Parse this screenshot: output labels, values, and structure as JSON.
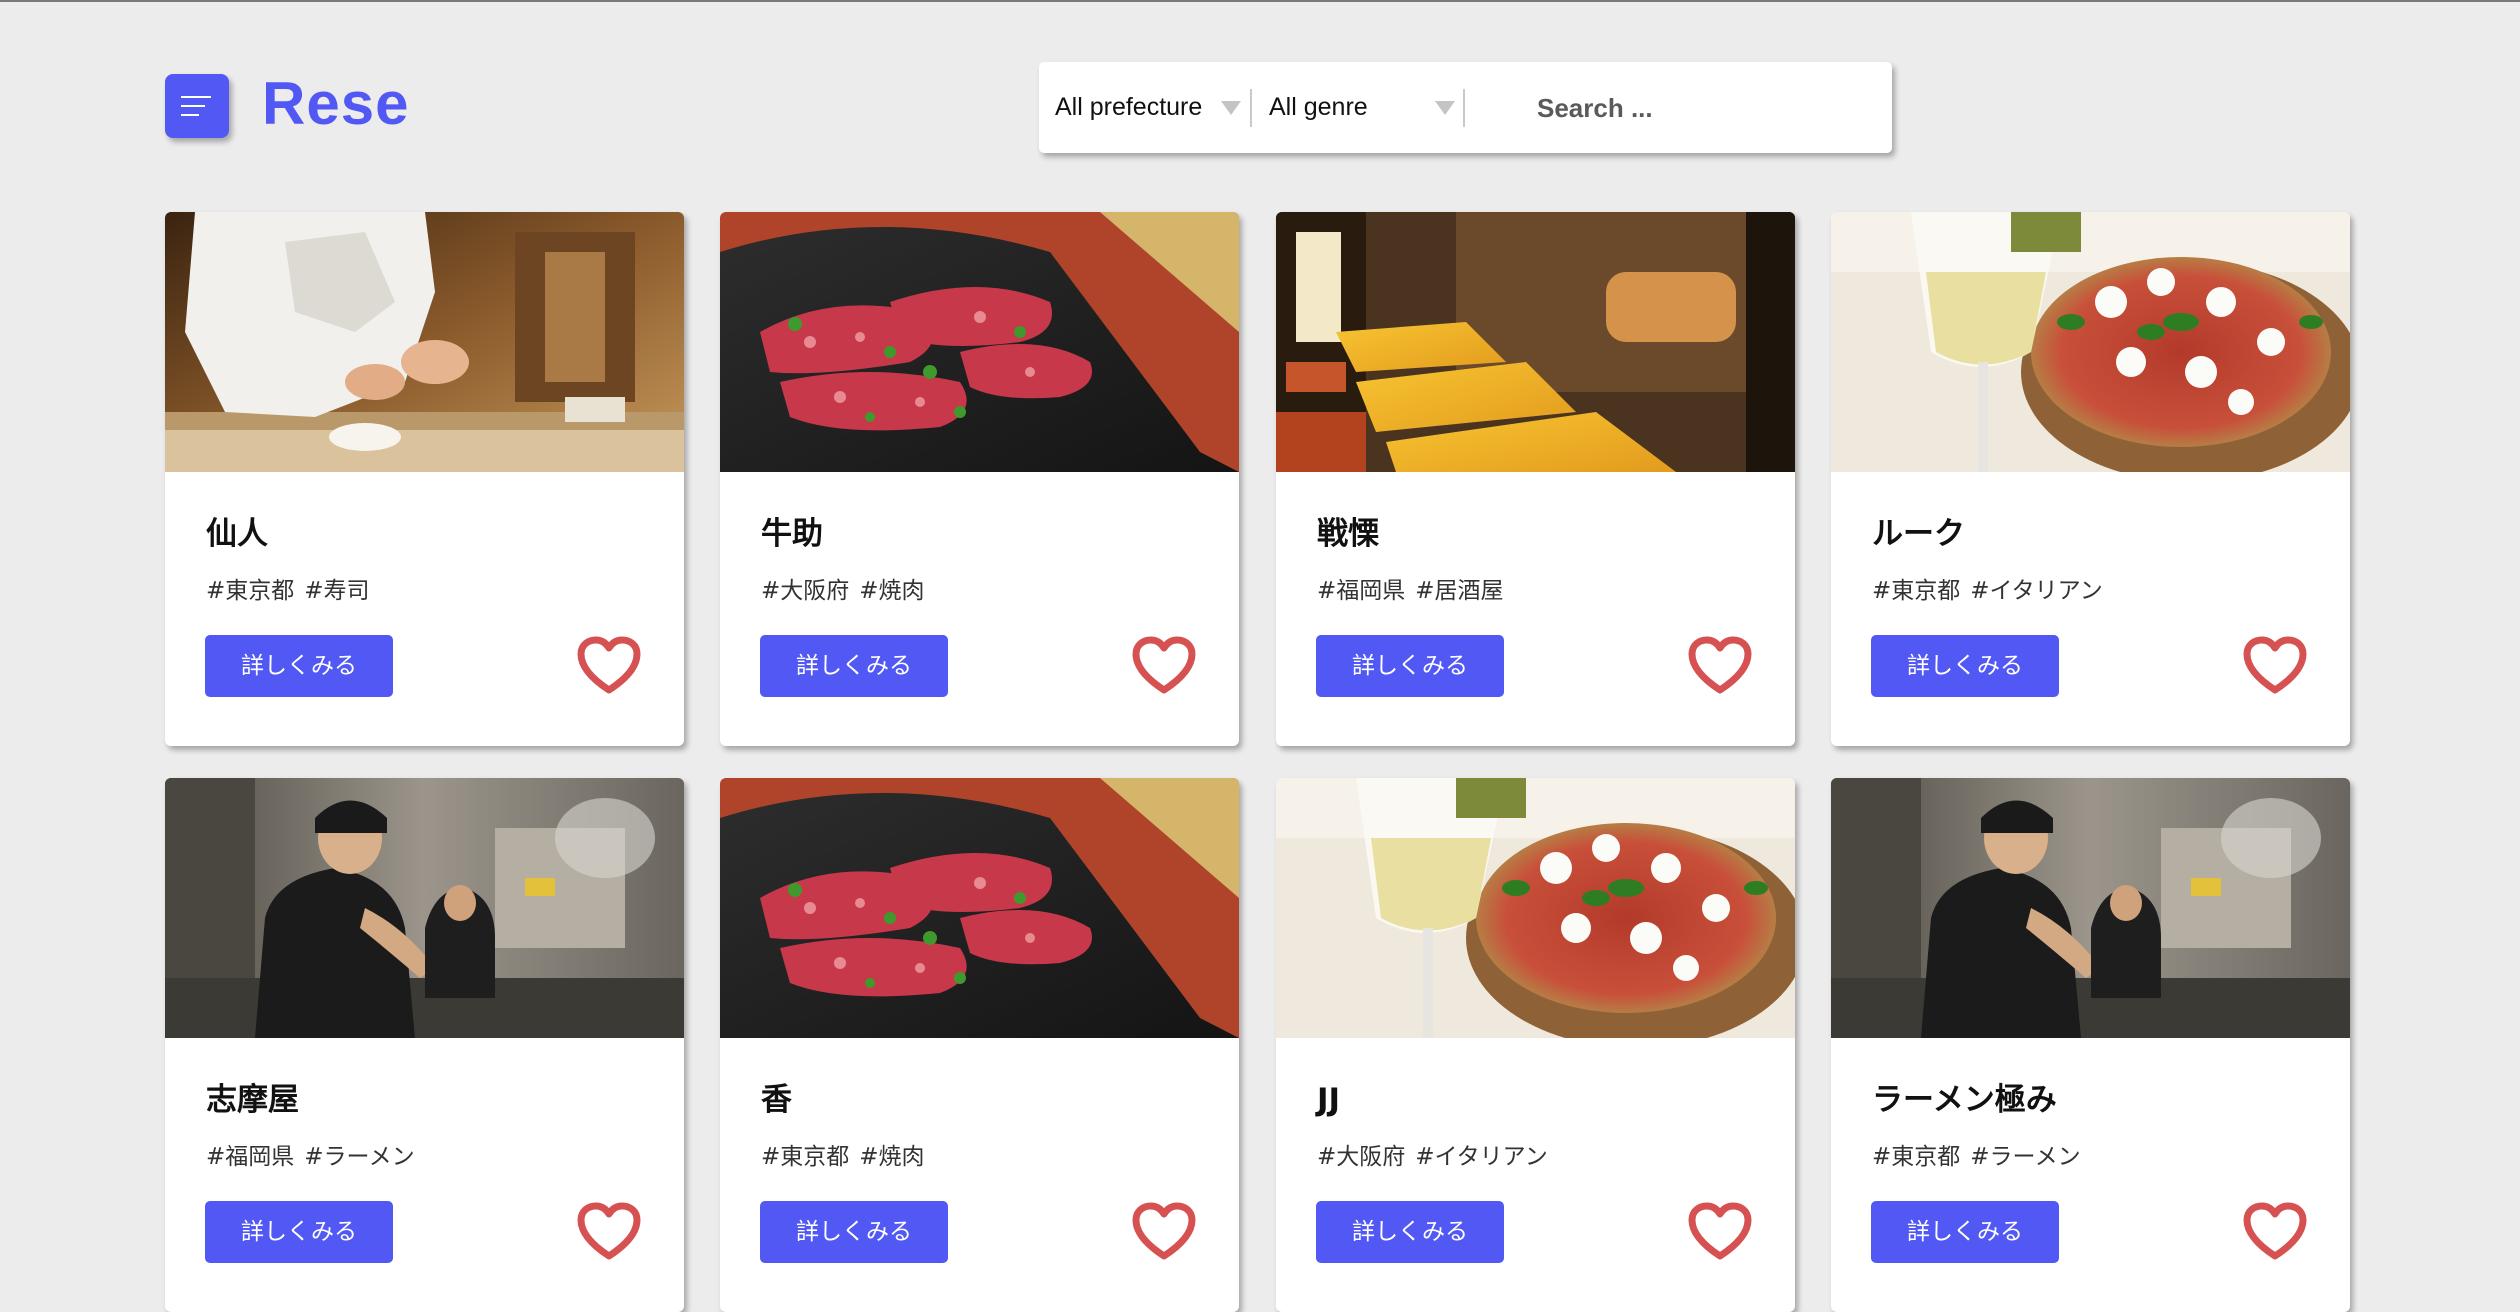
{
  "app": {
    "logo_text": "Rese",
    "accent_color": "#5158f4",
    "favorite_color": "#d9534f"
  },
  "search": {
    "prefecture_selected": "All prefecture",
    "genre_selected": "All genre",
    "placeholder": "Search ..."
  },
  "shops": [
    {
      "name": "仙人",
      "area": "#東京都",
      "genre": "#寿司",
      "image": "sushi-chef-photo",
      "button_label": "詳しくみる",
      "favorite_icon": "heart-outline-icon"
    },
    {
      "name": "牛助",
      "area": "#大阪府",
      "genre": "#焼肉",
      "image": "yakiniku-meat-photo",
      "button_label": "詳しくみる",
      "favorite_icon": "heart-outline-icon"
    },
    {
      "name": "戦慄",
      "area": "#福岡県",
      "genre": "#居酒屋",
      "image": "izakaya-interior-photo",
      "button_label": "詳しくみる",
      "favorite_icon": "heart-outline-icon"
    },
    {
      "name": "ルーク",
      "area": "#東京都",
      "genre": "#イタリアン",
      "image": "pizza-wine-photo",
      "button_label": "詳しくみる",
      "favorite_icon": "heart-outline-icon"
    },
    {
      "name": "志摩屋",
      "area": "#福岡県",
      "genre": "#ラーメン",
      "image": "ramen-cook-photo",
      "button_label": "詳しくみる",
      "favorite_icon": "heart-outline-icon"
    },
    {
      "name": "香",
      "area": "#東京都",
      "genre": "#焼肉",
      "image": "yakiniku-meat-photo",
      "button_label": "詳しくみる",
      "favorite_icon": "heart-outline-icon"
    },
    {
      "name": "JJ",
      "area": "#大阪府",
      "genre": "#イタリアン",
      "image": "pizza-wine-photo",
      "button_label": "詳しくみる",
      "favorite_icon": "heart-outline-icon"
    },
    {
      "name": "ラーメン極み",
      "area": "#東京都",
      "genre": "#ラーメン",
      "image": "ramen-cook-photo",
      "button_label": "詳しくみる",
      "favorite_icon": "heart-outline-icon"
    }
  ]
}
